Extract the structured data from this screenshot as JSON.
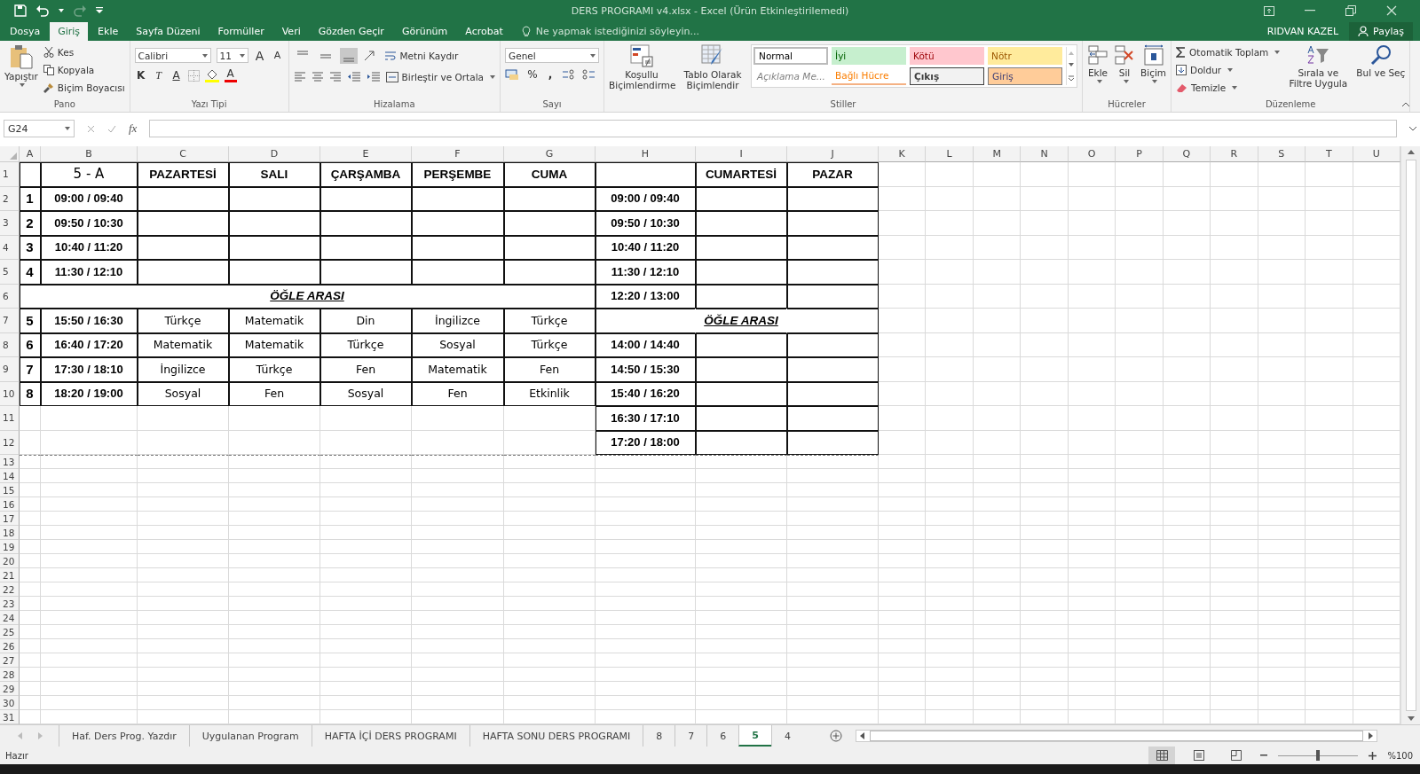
{
  "window": {
    "title": "DERS PROGRAMI v4.xlsx - Excel (Ürün Etkinleştirilemedi)",
    "user": "RIDVAN KAZEL",
    "share": "Paylaş"
  },
  "tabs": [
    {
      "label": "Dosya",
      "selected": false
    },
    {
      "label": "Giriş",
      "selected": true
    },
    {
      "label": "Ekle",
      "selected": false
    },
    {
      "label": "Sayfa Düzeni",
      "selected": false
    },
    {
      "label": "Formüller",
      "selected": false
    },
    {
      "label": "Veri",
      "selected": false
    },
    {
      "label": "Gözden Geçir",
      "selected": false
    },
    {
      "label": "Görünüm",
      "selected": false
    },
    {
      "label": "Acrobat",
      "selected": false
    }
  ],
  "tell_me": {
    "placeholder": "Ne yapmak istediğinizi söyleyin..."
  },
  "ribbon": {
    "clipboard": {
      "label": "Pano",
      "paste": "Yapıştır",
      "cut": "Kes",
      "copy": "Kopyala",
      "format_painter": "Biçim Boyacısı"
    },
    "font": {
      "label": "Yazı Tipi",
      "font_name": "Calibri",
      "font_size": "11",
      "grow": "A",
      "shrink": "A",
      "bold": "K",
      "italic": "T",
      "underline": "A",
      "font_color": "A"
    },
    "alignment": {
      "label": "Hizalama",
      "vertical": [
        {
          "selected": false
        },
        {
          "selected": false
        },
        {
          "selected": true
        }
      ],
      "wrap_text": "Metni Kaydır",
      "merge_center": "Birleştir ve Ortala"
    },
    "number": {
      "label": "Sayı",
      "format": "Genel",
      "percent": "%",
      "comma": ","
    },
    "styles": {
      "label": "Stiller",
      "conditional": "Koşullu Biçimlendirme",
      "format_table": "Tablo Olarak Biçimlendir",
      "gallery": [
        {
          "label": "Normal",
          "kind": "normal"
        },
        {
          "label": "İyi",
          "kind": "good"
        },
        {
          "label": "Kötü",
          "kind": "bad"
        },
        {
          "label": "Nötr",
          "kind": "neutral"
        },
        {
          "label": "Açıklama Me...",
          "kind": "note"
        },
        {
          "label": "Bağlı Hücre",
          "kind": "linked"
        },
        {
          "label": "Çıkış",
          "kind": "output"
        },
        {
          "label": "Giriş",
          "kind": "input"
        }
      ]
    },
    "cells": {
      "label": "Hücreler",
      "insert": "Ekle",
      "delete": "Sil",
      "format": "Biçim"
    },
    "editing": {
      "label": "Düzenleme",
      "autosum": "Otomatik Toplam",
      "fill": "Doldur",
      "clear": "Temizle",
      "sort_filter": "Sırala ve Filtre Uygula",
      "find_select": "Bul ve Seç"
    }
  },
  "formula_bar": {
    "name_box": "G24",
    "fx": "fx"
  },
  "sheet": {
    "columns": [
      "A",
      "B",
      "C",
      "D",
      "E",
      "F",
      "G",
      "H",
      "I",
      "J",
      "K",
      "L",
      "M",
      "N",
      "O",
      "P",
      "Q",
      "R",
      "S",
      "T",
      "U"
    ],
    "rows": [
      {
        "number": "1",
        "cells": [
          {
            "kind": "blank"
          },
          {
            "kind": "title",
            "text": "5 - A"
          },
          {
            "kind": "day",
            "text": "PAZARTESİ"
          },
          {
            "kind": "day",
            "text": "SALI"
          },
          {
            "kind": "day",
            "text": "ÇARŞAMBA"
          },
          {
            "kind": "day",
            "text": "PERŞEMBE"
          },
          {
            "kind": "day",
            "text": "CUMA"
          },
          {
            "kind": "blank"
          },
          {
            "kind": "day",
            "text": "CUMARTESİ"
          },
          {
            "kind": "day",
            "text": "PAZAR"
          }
        ]
      },
      {
        "number": "2",
        "cells": [
          {
            "kind": "num",
            "text": "1"
          },
          {
            "kind": "time",
            "text": "09:00 / 09:40"
          },
          {
            "kind": "blank"
          },
          {
            "kind": "blank"
          },
          {
            "kind": "blank"
          },
          {
            "kind": "blank"
          },
          {
            "kind": "blank"
          },
          {
            "kind": "time",
            "text": "09:00 / 09:40"
          },
          {
            "kind": "blank"
          },
          {
            "kind": "blank"
          }
        ]
      },
      {
        "number": "3",
        "cells": [
          {
            "kind": "num",
            "text": "2"
          },
          {
            "kind": "time",
            "text": "09:50 / 10:30"
          },
          {
            "kind": "blank"
          },
          {
            "kind": "blank"
          },
          {
            "kind": "blank"
          },
          {
            "kind": "blank"
          },
          {
            "kind": "blank"
          },
          {
            "kind": "time",
            "text": "09:50 / 10:30"
          },
          {
            "kind": "blank"
          },
          {
            "kind": "blank"
          }
        ]
      },
      {
        "number": "4",
        "cells": [
          {
            "kind": "num",
            "text": "3"
          },
          {
            "kind": "time",
            "text": "10:40 / 11:20"
          },
          {
            "kind": "blank"
          },
          {
            "kind": "blank"
          },
          {
            "kind": "blank"
          },
          {
            "kind": "blank"
          },
          {
            "kind": "blank"
          },
          {
            "kind": "time",
            "text": "10:40 / 11:20"
          },
          {
            "kind": "blank"
          },
          {
            "kind": "blank"
          }
        ]
      },
      {
        "number": "5",
        "cells": [
          {
            "kind": "num",
            "text": "4"
          },
          {
            "kind": "time",
            "text": "11:30 / 12:10"
          },
          {
            "kind": "blank"
          },
          {
            "kind": "blank"
          },
          {
            "kind": "blank"
          },
          {
            "kind": "blank"
          },
          {
            "kind": "blank"
          },
          {
            "kind": "time",
            "text": "11:30 / 12:10"
          },
          {
            "kind": "blank"
          },
          {
            "kind": "blank"
          }
        ]
      },
      {
        "number": "6",
        "cells": [
          {
            "kind": "break",
            "text": "ÖĞLE ARASI"
          },
          {
            "kind": "time",
            "text": "12:20 / 13:00"
          },
          {
            "kind": "blank"
          },
          {
            "kind": "blank"
          }
        ]
      },
      {
        "number": "7",
        "cells": [
          {
            "kind": "num",
            "text": "5"
          },
          {
            "kind": "time",
            "text": "15:50 / 16:30"
          },
          {
            "kind": "subject",
            "text": "Türkçe"
          },
          {
            "kind": "subject",
            "text": "Matematik"
          },
          {
            "kind": "subject",
            "text": "Din"
          },
          {
            "kind": "subject",
            "text": "İngilizce"
          },
          {
            "kind": "subject",
            "text": "Türkçe"
          },
          {
            "kind": "merge_start"
          },
          {
            "kind": "break",
            "text": "ÖĞLE ARASI"
          },
          {
            "kind": "merge_end"
          }
        ]
      },
      {
        "number": "8",
        "cells": [
          {
            "kind": "num",
            "text": "6"
          },
          {
            "kind": "time",
            "text": "16:40 / 17:20"
          },
          {
            "kind": "subject",
            "text": "Matematik"
          },
          {
            "kind": "subject",
            "text": "Matematik"
          },
          {
            "kind": "subject",
            "text": "Türkçe"
          },
          {
            "kind": "subject",
            "text": "Sosyal"
          },
          {
            "kind": "subject",
            "text": "Türkçe"
          },
          {
            "kind": "time",
            "text": "14:00 / 14:40"
          },
          {
            "kind": "blank"
          },
          {
            "kind": "blank"
          }
        ]
      },
      {
        "number": "9",
        "cells": [
          {
            "kind": "num",
            "text": "7"
          },
          {
            "kind": "time",
            "text": "17:30 / 18:10"
          },
          {
            "kind": "subject",
            "text": "İngilizce"
          },
          {
            "kind": "subject",
            "text": "Türkçe"
          },
          {
            "kind": "subject",
            "text": "Fen"
          },
          {
            "kind": "subject",
            "text": "Matematik"
          },
          {
            "kind": "subject",
            "text": "Fen"
          },
          {
            "kind": "time",
            "text": "14:50 / 15:30"
          },
          {
            "kind": "blank"
          },
          {
            "kind": "blank"
          }
        ]
      },
      {
        "number": "10",
        "cells": [
          {
            "kind": "num",
            "text": "8"
          },
          {
            "kind": "time",
            "text": "18:20 / 19:00"
          },
          {
            "kind": "subject",
            "text": "Sosyal"
          },
          {
            "kind": "subject",
            "text": "Fen"
          },
          {
            "kind": "subject",
            "text": "Sosyal"
          },
          {
            "kind": "subject",
            "text": "Fen"
          },
          {
            "kind": "subject",
            "text": "Etkinlik"
          },
          {
            "kind": "time",
            "text": "15:40 / 16:20"
          },
          {
            "kind": "blank"
          },
          {
            "kind": "blank"
          }
        ]
      },
      {
        "number": "11",
        "cells": [
          {
            "kind": "none"
          },
          {
            "kind": "time",
            "text": "16:30 / 17:10"
          },
          {
            "kind": "blank"
          },
          {
            "kind": "blank"
          }
        ]
      },
      {
        "number": "12",
        "cells": [
          {
            "kind": "none"
          },
          {
            "kind": "time",
            "text": "17:20 / 18:00"
          },
          {
            "kind": "blank"
          },
          {
            "kind": "blank"
          }
        ]
      }
    ],
    "empty_rows": [
      "13",
      "14",
      "15",
      "16",
      "17",
      "18",
      "19",
      "20",
      "21",
      "22",
      "23",
      "24",
      "25",
      "26",
      "27",
      "28",
      "29",
      "30",
      "31"
    ]
  },
  "sheet_tabs": [
    {
      "label": "Haf. Ders Prog. Yazdır",
      "selected": false
    },
    {
      "label": "Uygulanan Program",
      "selected": false
    },
    {
      "label": "HAFTA İÇİ DERS PROGRAMI",
      "selected": false
    },
    {
      "label": "HAFTA SONU DERS PROGRAMI",
      "selected": false
    },
    {
      "label": "8",
      "selected": false
    },
    {
      "label": "7",
      "selected": false
    },
    {
      "label": "6",
      "selected": false
    },
    {
      "label": "5",
      "selected": true
    },
    {
      "label": "4",
      "selected": false
    }
  ],
  "status_bar": {
    "status": "Hazır",
    "views": [
      {
        "selected": true
      },
      {
        "selected": false
      },
      {
        "selected": false
      }
    ],
    "zoom": {
      "level": 0.5
    },
    "zoom_reading": "%100"
  }
}
